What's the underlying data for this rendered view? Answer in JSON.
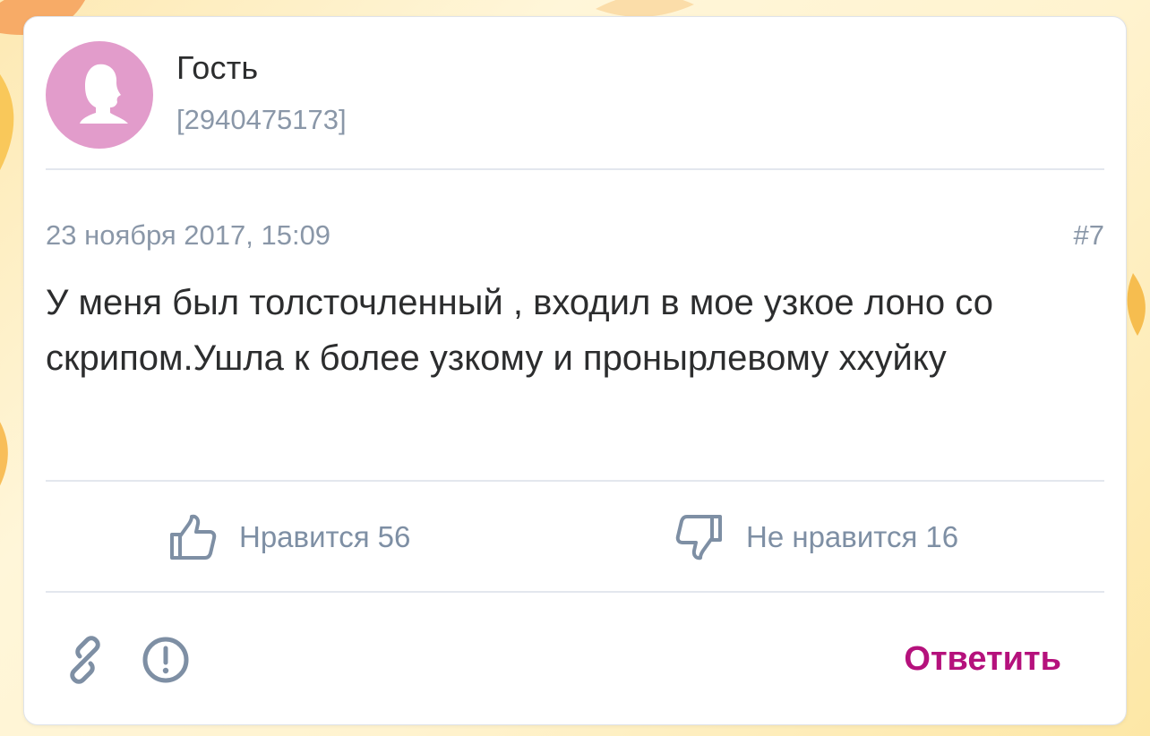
{
  "post": {
    "author": {
      "name": "Гость",
      "id": "[2940475173]",
      "avatar_icon": "user-silhouette-icon",
      "avatar_color": "#e29ccb"
    },
    "date": "23 ноября 2017, 15:09",
    "number": "#7",
    "text": "У меня был толсточленный , входил в мое узкое лоно со скрипом.Ушла к более узкому и пронырлевому ххуйку"
  },
  "actions": {
    "like": {
      "icon": "thumbs-up-icon",
      "label": "Нравится",
      "count": "56"
    },
    "dislike": {
      "icon": "thumbs-down-icon",
      "label": "Не нравится",
      "count": "16"
    },
    "link_icon": "link-icon",
    "report_icon": "exclamation-circle-icon",
    "reply_label": "Ответить"
  },
  "colors": {
    "accent": "#b5117c",
    "muted": "#8a97a8",
    "action": "#7e8fa4"
  }
}
